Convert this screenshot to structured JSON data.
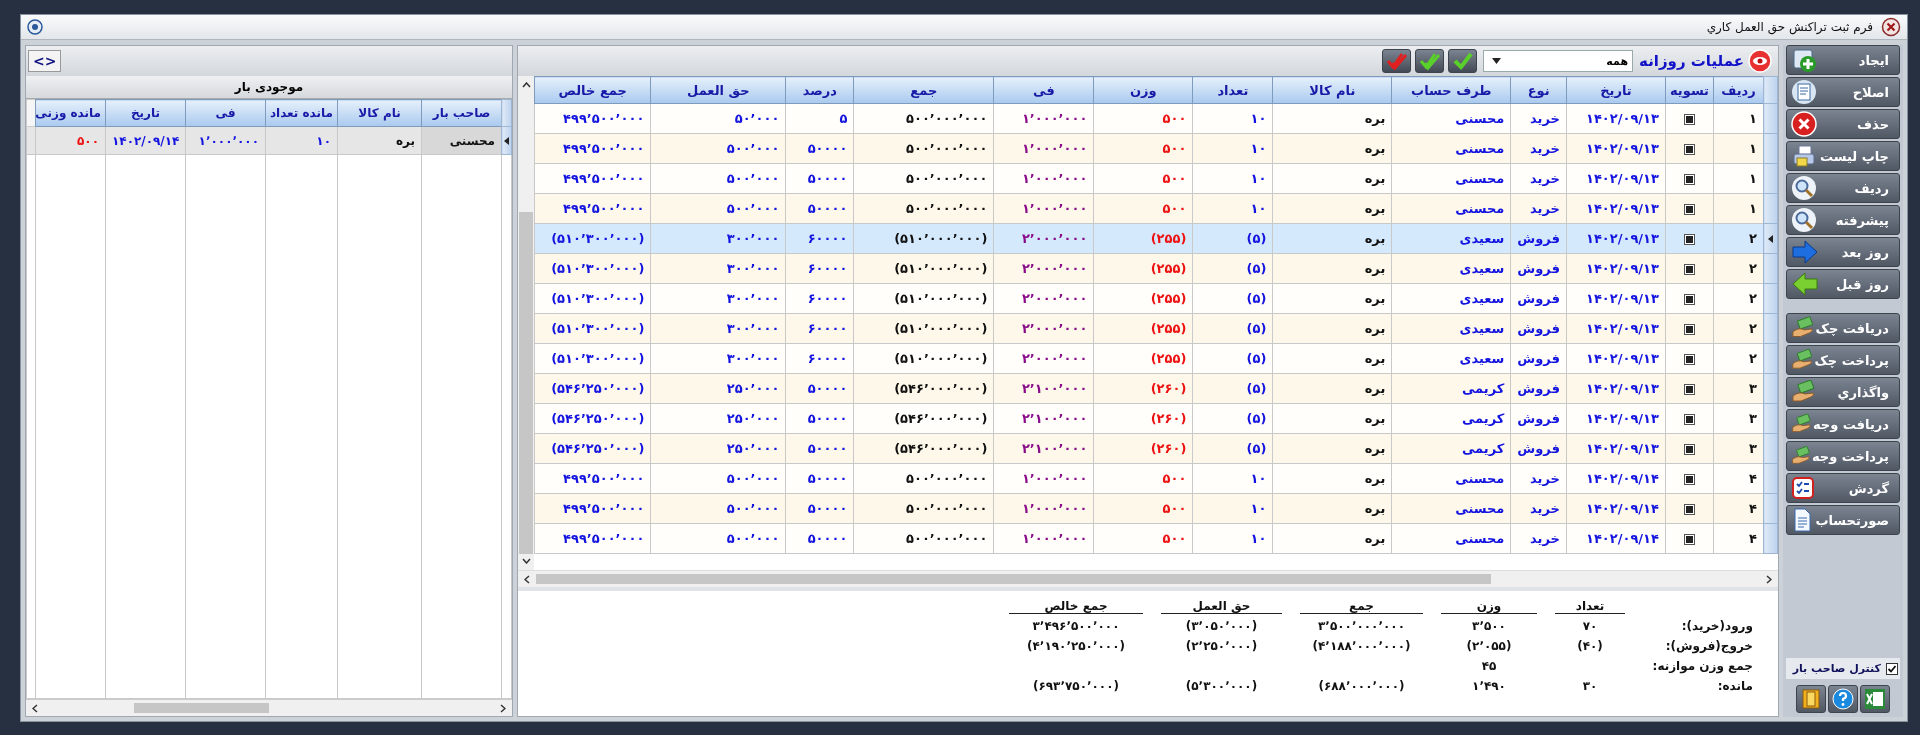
{
  "window": {
    "title": "فرم ثبت تراکنش حق العمل کاري"
  },
  "sidebar": {
    "buttons": [
      {
        "label": "ایجاد"
      },
      {
        "label": "اصلاح"
      },
      {
        "label": "حذف"
      },
      {
        "label": "چاپ لیست"
      },
      {
        "label": "ردیف"
      },
      {
        "label": "پیشرفته"
      },
      {
        "label": "روز بعد"
      },
      {
        "label": "روز قبل"
      }
    ],
    "finance_buttons": [
      {
        "label": "دریافت چک"
      },
      {
        "label": "پرداخت چک"
      },
      {
        "label": "واگذاري"
      },
      {
        "label": "دریافت وجه"
      },
      {
        "label": "پرداخت وجه"
      },
      {
        "label": "گردش"
      },
      {
        "label": "صورتحساب"
      }
    ],
    "owner_control": {
      "label": "کنترل صاحب بار",
      "checked": true
    }
  },
  "toolbar": {
    "title": "عملیات روزانه",
    "filter": "همه"
  },
  "table": {
    "columns": [
      "ردیف",
      "تسویه",
      "تاریخ",
      "نوع",
      "طرف حساب",
      "نام کالا",
      "تعداد",
      "وزن",
      "فی",
      "جمع",
      "درصد",
      "حق العمل",
      "جمع خالص"
    ],
    "rows": [
      {
        "selected": false,
        "settled": true,
        "cells": [
          "۱",
          "",
          "۱۴۰۲/۰۹/۱۳",
          "خرید",
          "محسنی",
          "بره",
          "۱۰",
          "۵۰۰",
          "۱٬۰۰۰٬۰۰۰",
          "۵۰۰٬۰۰۰٬۰۰۰",
          "۵",
          "۵۰٬۰۰۰",
          "۴۹۹٬۵۰۰٬۰۰۰"
        ]
      },
      {
        "selected": false,
        "settled": true,
        "cells": [
          "۱",
          "",
          "۱۴۰۲/۰۹/۱۳",
          "خرید",
          "محسنی",
          "بره",
          "۱۰",
          "۵۰۰",
          "۱٬۰۰۰٬۰۰۰",
          "۵۰۰٬۰۰۰٬۰۰۰",
          "۵۰۰۰۰",
          "۵۰۰٬۰۰۰",
          "۴۹۹٬۵۰۰٬۰۰۰"
        ]
      },
      {
        "selected": false,
        "settled": true,
        "cells": [
          "۱",
          "",
          "۱۴۰۲/۰۹/۱۳",
          "خرید",
          "محسنی",
          "بره",
          "۱۰",
          "۵۰۰",
          "۱٬۰۰۰٬۰۰۰",
          "۵۰۰٬۰۰۰٬۰۰۰",
          "۵۰۰۰۰",
          "۵۰۰٬۰۰۰",
          "۴۹۹٬۵۰۰٬۰۰۰"
        ]
      },
      {
        "selected": false,
        "settled": true,
        "cells": [
          "۱",
          "",
          "۱۴۰۲/۰۹/۱۳",
          "خرید",
          "محسنی",
          "بره",
          "۱۰",
          "۵۰۰",
          "۱٬۰۰۰٬۰۰۰",
          "۵۰۰٬۰۰۰٬۰۰۰",
          "۵۰۰۰۰",
          "۵۰۰٬۰۰۰",
          "۴۹۹٬۵۰۰٬۰۰۰"
        ]
      },
      {
        "selected": true,
        "settled": true,
        "cells": [
          "۲",
          "",
          "۱۴۰۲/۰۹/۱۳",
          "فروش",
          "سعیدی",
          "بره",
          "(۵)",
          "(۲۵۵)",
          "۲٬۰۰۰٬۰۰۰",
          "(۵۱۰٬۰۰۰٬۰۰۰)",
          "۶۰۰۰۰",
          "۳۰۰٬۰۰۰",
          "(۵۱۰٬۳۰۰٬۰۰۰)"
        ]
      },
      {
        "selected": false,
        "settled": true,
        "cells": [
          "۲",
          "",
          "۱۴۰۲/۰۹/۱۳",
          "فروش",
          "سعیدی",
          "بره",
          "(۵)",
          "(۲۵۵)",
          "۲٬۰۰۰٬۰۰۰",
          "(۵۱۰٬۰۰۰٬۰۰۰)",
          "۶۰۰۰۰",
          "۳۰۰٬۰۰۰",
          "(۵۱۰٬۳۰۰٬۰۰۰)"
        ]
      },
      {
        "selected": false,
        "settled": true,
        "cells": [
          "۲",
          "",
          "۱۴۰۲/۰۹/۱۳",
          "فروش",
          "سعیدی",
          "بره",
          "(۵)",
          "(۲۵۵)",
          "۲٬۰۰۰٬۰۰۰",
          "(۵۱۰٬۰۰۰٬۰۰۰)",
          "۶۰۰۰۰",
          "۳۰۰٬۰۰۰",
          "(۵۱۰٬۳۰۰٬۰۰۰)"
        ]
      },
      {
        "selected": false,
        "settled": true,
        "cells": [
          "۲",
          "",
          "۱۴۰۲/۰۹/۱۳",
          "فروش",
          "سعیدی",
          "بره",
          "(۵)",
          "(۲۵۵)",
          "۲٬۰۰۰٬۰۰۰",
          "(۵۱۰٬۰۰۰٬۰۰۰)",
          "۶۰۰۰۰",
          "۳۰۰٬۰۰۰",
          "(۵۱۰٬۳۰۰٬۰۰۰)"
        ]
      },
      {
        "selected": false,
        "settled": true,
        "cells": [
          "۲",
          "",
          "۱۴۰۲/۰۹/۱۳",
          "فروش",
          "سعیدی",
          "بره",
          "(۵)",
          "(۲۵۵)",
          "۲٬۰۰۰٬۰۰۰",
          "(۵۱۰٬۰۰۰٬۰۰۰)",
          "۶۰۰۰۰",
          "۳۰۰٬۰۰۰",
          "(۵۱۰٬۳۰۰٬۰۰۰)"
        ]
      },
      {
        "selected": false,
        "settled": true,
        "cells": [
          "۳",
          "",
          "۱۴۰۲/۰۹/۱۳",
          "فروش",
          "کریمی",
          "بره",
          "(۵)",
          "(۲۶۰)",
          "۲٬۱۰۰٬۰۰۰",
          "(۵۴۶٬۰۰۰٬۰۰۰)",
          "۵۰۰۰۰",
          "۲۵۰٬۰۰۰",
          "(۵۴۶٬۲۵۰٬۰۰۰)"
        ]
      },
      {
        "selected": false,
        "settled": true,
        "cells": [
          "۳",
          "",
          "۱۴۰۲/۰۹/۱۳",
          "فروش",
          "کریمی",
          "بره",
          "(۵)",
          "(۲۶۰)",
          "۲٬۱۰۰٬۰۰۰",
          "(۵۴۶٬۰۰۰٬۰۰۰)",
          "۵۰۰۰۰",
          "۲۵۰٬۰۰۰",
          "(۵۴۶٬۲۵۰٬۰۰۰)"
        ]
      },
      {
        "selected": false,
        "settled": true,
        "cells": [
          "۳",
          "",
          "۱۴۰۲/۰۹/۱۳",
          "فروش",
          "کریمی",
          "بره",
          "(۵)",
          "(۲۶۰)",
          "۲٬۱۰۰٬۰۰۰",
          "(۵۴۶٬۰۰۰٬۰۰۰)",
          "۵۰۰۰۰",
          "۲۵۰٬۰۰۰",
          "(۵۴۶٬۲۵۰٬۰۰۰)"
        ]
      },
      {
        "selected": false,
        "settled": true,
        "cells": [
          "۴",
          "",
          "۱۴۰۲/۰۹/۱۴",
          "خرید",
          "محسنی",
          "بره",
          "۱۰",
          "۵۰۰",
          "۱٬۰۰۰٬۰۰۰",
          "۵۰۰٬۰۰۰٬۰۰۰",
          "۵۰۰۰۰",
          "۵۰۰٬۰۰۰",
          "۴۹۹٬۵۰۰٬۰۰۰"
        ]
      },
      {
        "selected": false,
        "settled": true,
        "cells": [
          "۴",
          "",
          "۱۴۰۲/۰۹/۱۴",
          "خرید",
          "محسنی",
          "بره",
          "۱۰",
          "۵۰۰",
          "۱٬۰۰۰٬۰۰۰",
          "۵۰۰٬۰۰۰٬۰۰۰",
          "۵۰۰۰۰",
          "۵۰۰٬۰۰۰",
          "۴۹۹٬۵۰۰٬۰۰۰"
        ]
      },
      {
        "selected": false,
        "settled": true,
        "cells": [
          "۴",
          "",
          "۱۴۰۲/۰۹/۱۴",
          "خرید",
          "محسنی",
          "بره",
          "۱۰",
          "۵۰۰",
          "۱٬۰۰۰٬۰۰۰",
          "۵۰۰٬۰۰۰٬۰۰۰",
          "۵۰۰۰۰",
          "۵۰۰٬۰۰۰",
          "۴۹۹٬۵۰۰٬۰۰۰"
        ]
      }
    ]
  },
  "summary": {
    "columns": [
      "تعداد",
      "وزن",
      "جمع",
      "حق العمل",
      "جمع خالص"
    ],
    "rows": [
      {
        "label": "ورود(خرید):",
        "values": [
          "۷۰",
          "۳٬۵۰۰",
          "۳٬۵۰۰٬۰۰۰٬۰۰۰",
          "(۳٬۰۵۰٬۰۰۰)",
          "۳٬۴۹۶٬۵۰۰٬۰۰۰"
        ]
      },
      {
        "label": "خروج(فروش):",
        "values": [
          "(۴۰)",
          "(۲٬۰۵۵)",
          "(۴٬۱۸۸٬۰۰۰٬۰۰۰)",
          "(۲٬۲۵۰٬۰۰۰)",
          "(۴٬۱۹۰٬۲۵۰٬۰۰۰)"
        ]
      },
      {
        "label": "جمع وزن موازنه:",
        "weight": "۴۵"
      },
      {
        "label": "مانده:",
        "values": [
          "۳۰",
          "۱٬۴۹۰",
          "(۶۸۸٬۰۰۰٬۰۰۰)",
          "(۵٬۳۰۰٬۰۰۰)",
          "(۶۹۳٬۷۵۰٬۰۰۰)"
        ]
      }
    ]
  },
  "stock": {
    "toggle": "<>",
    "title": "موجودی بار",
    "columns": [
      "صاحب بار",
      "نام کالا",
      "مانده تعداد",
      "فی",
      "تاریخ",
      "مانده وزنی"
    ],
    "rows": [
      {
        "selected": true,
        "cells": [
          "محسنی",
          "بره",
          "۱۰",
          "۱٬۰۰۰٬۰۰۰",
          "۱۴۰۲/۰۹/۱۴",
          "۵۰۰"
        ]
      }
    ]
  }
}
